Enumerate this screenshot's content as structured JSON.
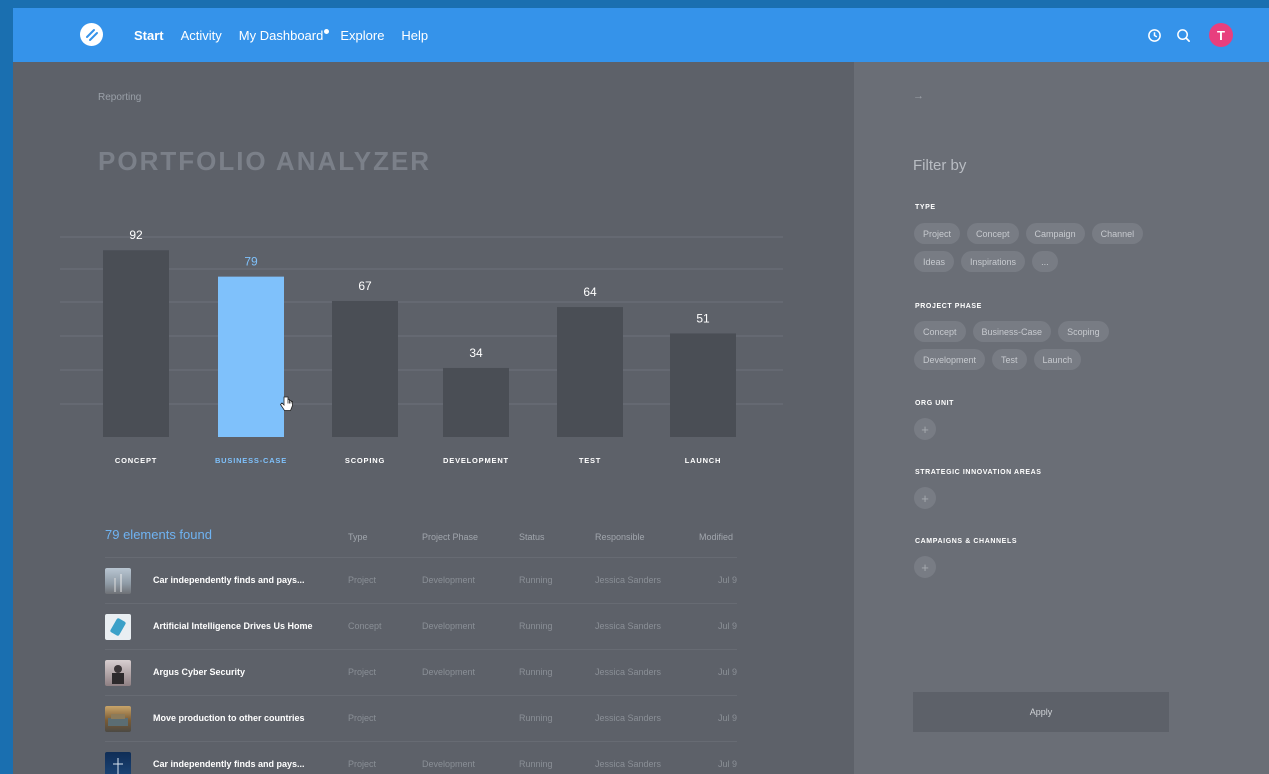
{
  "nav": {
    "items": [
      {
        "label": "Start",
        "active": true
      },
      {
        "label": "Activity",
        "active": false
      },
      {
        "label": "My Dashboard",
        "active": false,
        "dot": true
      },
      {
        "label": "Explore",
        "active": false
      },
      {
        "label": "Help",
        "active": false
      }
    ],
    "avatar_initial": "T",
    "icons": [
      "history-icon",
      "search-icon"
    ]
  },
  "main": {
    "breadcrumb": "Reporting",
    "title": "PORTFOLIO ANALYZER"
  },
  "chart_data": {
    "type": "bar",
    "categories": [
      "CONCEPT",
      "BUSINESS-CASE",
      "SCOPING",
      "DEVELOPMENT",
      "TEST",
      "LAUNCH"
    ],
    "values": [
      92,
      79,
      67,
      34,
      64,
      51
    ],
    "highlighted": "BUSINESS-CASE",
    "colors": {
      "bar": "#4a4e55",
      "highlight": "#7fc1fb",
      "label": "#ffffff"
    }
  },
  "list": {
    "found_text": "79 elements found",
    "columns": [
      "Type",
      "Project Phase",
      "Status",
      "Responsible",
      "Modified"
    ],
    "rows": [
      {
        "title": "Car independently finds and pays...",
        "type": "Project",
        "phase": "Development",
        "status": "Running",
        "responsible": "Jessica Sanders",
        "modified": "Jul 9"
      },
      {
        "title": "Artificial Intelligence Drives Us Home",
        "type": "Concept",
        "phase": "Development",
        "status": "Running",
        "responsible": "Jessica Sanders",
        "modified": "Jul 9"
      },
      {
        "title": "Argus Cyber Security",
        "type": "Project",
        "phase": "Development",
        "status": "Running",
        "responsible": "Jessica Sanders",
        "modified": "Jul 9"
      },
      {
        "title": "Move production to other countries",
        "type": "Project",
        "phase": "",
        "status": "Running",
        "responsible": "Jessica Sanders",
        "modified": "Jul 9"
      },
      {
        "title": "Car independently finds and pays...",
        "type": "Project",
        "phase": "Development",
        "status": "Running",
        "responsible": "Jessica Sanders",
        "modified": "Jul 9"
      }
    ]
  },
  "sidebar": {
    "arrow": "→",
    "filter_title": "Filter by",
    "sections": {
      "type": {
        "label": "TYPE",
        "chips": [
          "Project",
          "Concept",
          "Campaign",
          "Channel",
          "Ideas",
          "Inspirations",
          "..."
        ]
      },
      "phase": {
        "label": "PROJECT PHASE",
        "chips": [
          "Concept",
          "Business-Case",
          "Scoping",
          "Development",
          "Test",
          "Launch"
        ]
      },
      "org": {
        "label": "ORG UNIT"
      },
      "strategic": {
        "label": "STRATEGIC INNOVATION AREAS"
      },
      "campaigns": {
        "label": "CAMPAIGNS & CHANNELS"
      }
    },
    "plus": "+",
    "apply_label": "Apply"
  }
}
